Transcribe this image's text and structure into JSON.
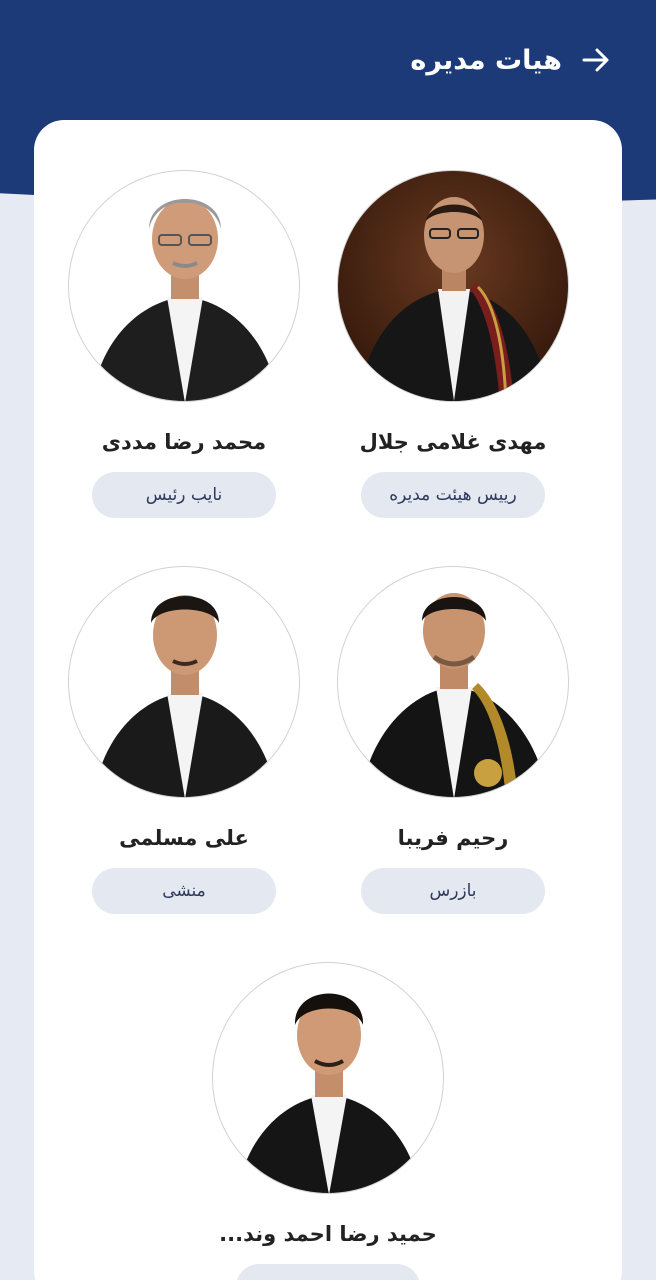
{
  "header": {
    "title": "هیات مدیره",
    "back_icon": "arrow-right-icon"
  },
  "colors": {
    "header_bg": "#1c3978",
    "page_bg": "#e6eaf2",
    "card_bg": "#ffffff",
    "role_pill_bg": "#e4e8f0"
  },
  "members": [
    {
      "name": "مهدی غلامی جلال",
      "role": "رییس هیئت مدیره"
    },
    {
      "name": "محمد رضا مددی",
      "role": "نایب رئیس"
    },
    {
      "name": "رحیم فریبا",
      "role": "بازرس"
    },
    {
      "name": "علی مسلمی",
      "role": "منشی"
    },
    {
      "name": "حمید رضا احمد وند...",
      "role": ""
    }
  ]
}
